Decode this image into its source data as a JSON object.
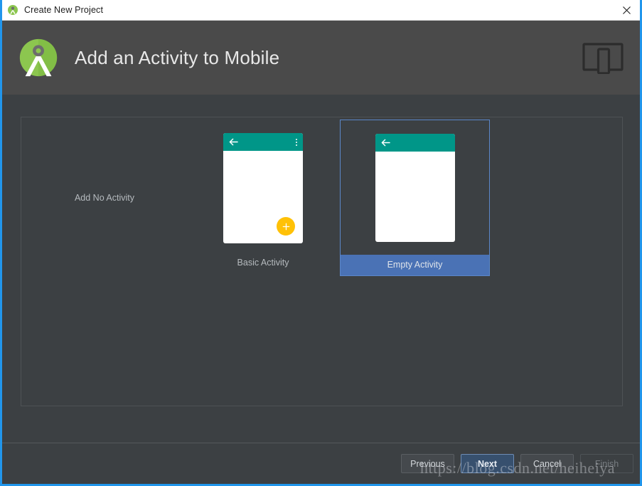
{
  "window": {
    "titlebar": {
      "app_icon": "android-studio-icon",
      "title": "Create New Project",
      "close_label": "close-icon"
    },
    "accent_color": "#2196ec"
  },
  "header": {
    "logo": "android-studio-logo",
    "title": "Add an Activity to Mobile",
    "form_factor_icon": "tablet-phone-icon",
    "background_color": "#4a4a4a"
  },
  "gallery": {
    "templates": [
      {
        "id": "no-activity",
        "label": "Add No Activity",
        "selected": false,
        "has_thumbnail": false
      },
      {
        "id": "basic-activity",
        "label": "Basic Activity",
        "selected": false,
        "has_thumbnail": true,
        "appbar_color": "#009688",
        "has_overflow_menu": true,
        "has_fab": true,
        "fab_color": "#ffc107",
        "fab_icon": "plus-icon",
        "back_icon": "back-arrow-icon"
      },
      {
        "id": "empty-activity",
        "label": "Empty Activity",
        "selected": true,
        "has_thumbnail": true,
        "appbar_color": "#009688",
        "has_overflow_menu": false,
        "has_fab": false,
        "back_icon": "back-arrow-icon"
      }
    ],
    "selection_color": "#4a72b5",
    "selection_border_color": "#5b87c9"
  },
  "footer": {
    "buttons": [
      {
        "id": "previous",
        "label": "Previous",
        "state": "enabled"
      },
      {
        "id": "next",
        "label": "Next",
        "state": "default"
      },
      {
        "id": "cancel",
        "label": "Cancel",
        "state": "enabled"
      },
      {
        "id": "finish",
        "label": "Finish",
        "state": "disabled"
      }
    ],
    "default_button_color": "#37506e"
  },
  "watermark": {
    "text": "https://blog.csdn.net/heiheiya"
  }
}
